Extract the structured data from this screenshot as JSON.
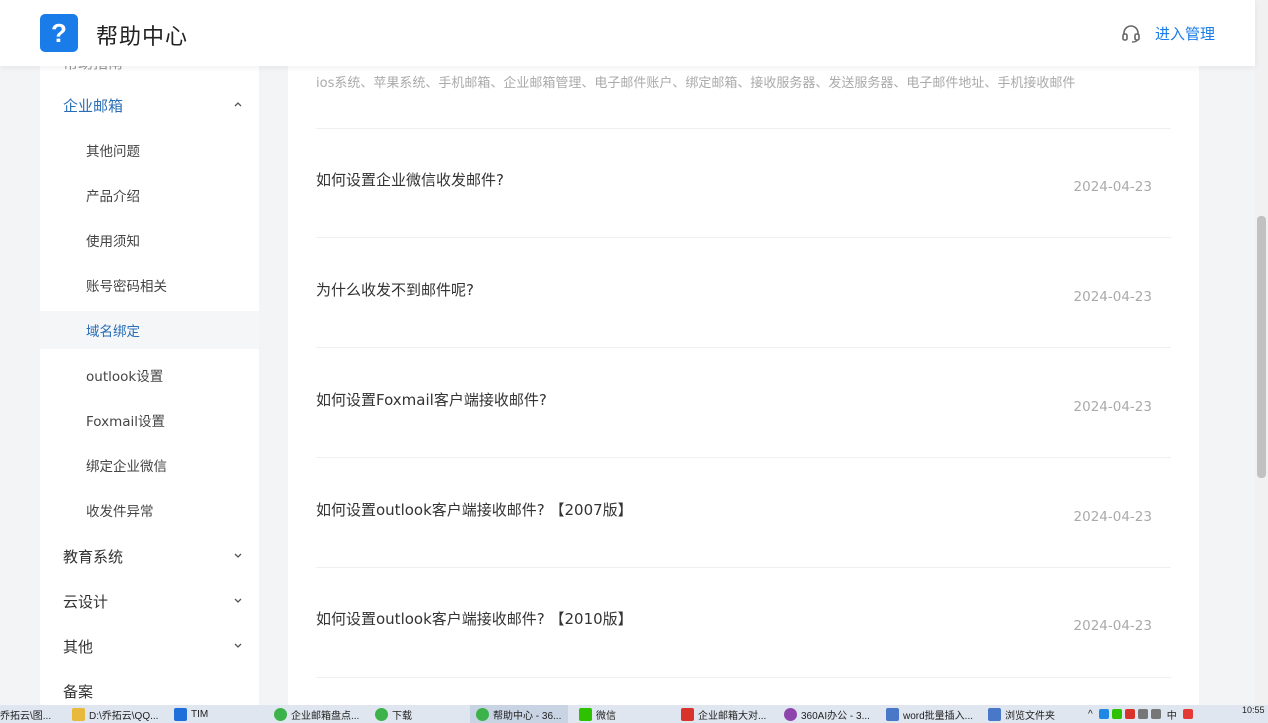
{
  "header": {
    "logo_glyph": "?",
    "brand_title": "帮助中心",
    "manage_link": "进入管理",
    "accent": "#1a7ce8"
  },
  "sidebar": {
    "cut_top_label": "帮助指南",
    "groups": [
      {
        "label": "企业邮箱",
        "expanded": true
      }
    ],
    "sub_items": [
      {
        "label": "其他问题"
      },
      {
        "label": "产品介绍"
      },
      {
        "label": "使用须知"
      },
      {
        "label": "账号密码相关"
      },
      {
        "label": "域名绑定",
        "active": true
      },
      {
        "label": "outlook设置"
      },
      {
        "label": "Foxmail设置"
      },
      {
        "label": "绑定企业微信"
      },
      {
        "label": "收发件异常"
      }
    ],
    "other_groups": [
      {
        "label": "教育系统"
      },
      {
        "label": "云设计"
      },
      {
        "label": "其他"
      },
      {
        "label": "备案"
      }
    ]
  },
  "main": {
    "keywords": "ios系统、苹果系统、手机邮箱、企业邮箱管理、电子邮件账户、绑定邮箱、接收服务器、发送服务器、电子邮件地址、手机接收邮件",
    "articles": [
      {
        "title": "如何设置企业微信收发邮件?",
        "date": "2024-04-23"
      },
      {
        "title": "为什么收发不到邮件呢?",
        "date": "2024-04-23"
      },
      {
        "title": "如何设置Foxmail客户端接收邮件?",
        "date": "2024-04-23"
      },
      {
        "title": "如何设置outlook客户端接收邮件? 【2007版】",
        "date": "2024-04-23"
      },
      {
        "title": "如何设置outlook客户端接收邮件? 【2010版】",
        "date": "2024-04-23"
      }
    ]
  },
  "taskbar": {
    "items": [
      {
        "label": "乔拓云\\图..."
      },
      {
        "label": "D:\\乔拓云\\QQ..."
      },
      {
        "label": "TIM"
      },
      {
        "label": "企业邮箱盘点..."
      },
      {
        "label": "下载"
      },
      {
        "label": "帮助中心 - 36...",
        "active": true
      },
      {
        "label": "微信"
      },
      {
        "label": "企业邮箱大对..."
      },
      {
        "label": "360AI办公 - 3..."
      },
      {
        "label": "word批量插入..."
      },
      {
        "label": "浏览文件夹"
      }
    ],
    "ime": "中",
    "clock": "10:55"
  }
}
